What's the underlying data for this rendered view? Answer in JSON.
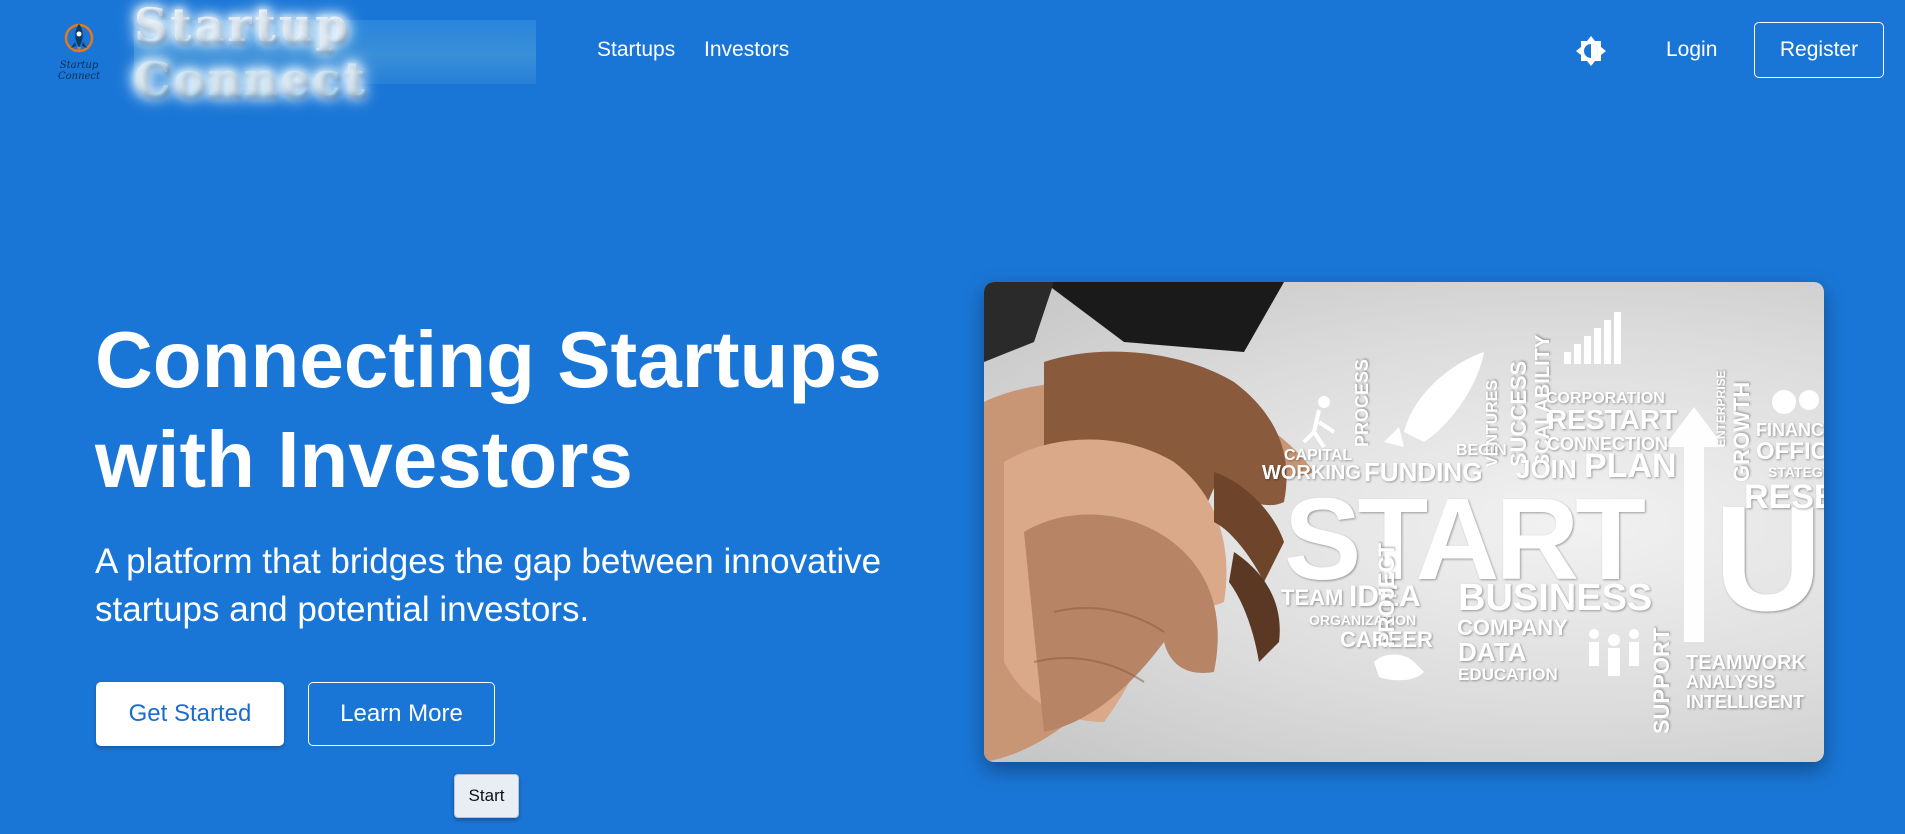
{
  "navbar": {
    "logo_caption": "Startup Connect",
    "brand_title": "Startup Connect",
    "links": {
      "startups": "Startups",
      "investors": "Investors"
    },
    "theme_toggle_icon": "sun-icon",
    "login": "Login",
    "register": "Register"
  },
  "hero": {
    "title_line1": "Connecting Startups",
    "title_line2": "with Investors",
    "subtitle_line1": "A platform that bridges the gap between innovative",
    "subtitle_line2": "startups and potential investors.",
    "get_started": "Get Started",
    "learn_more": "Learn More",
    "tooltip": "Start"
  },
  "hero_image": {
    "words": {
      "start": "START",
      "up": "U",
      "business": "BUSINESS",
      "idea": "IDEA",
      "team": "TEAM",
      "organization": "ORGANIZATION",
      "career": "CAREER",
      "company": "COMPANY",
      "data": "DATA",
      "education": "EDUCATION",
      "project": "PROJECT",
      "support": "SUPPORT",
      "teamwork": "TEAMWORK",
      "analysis": "ANALYSIS",
      "intelligent": "INTELLIGENT",
      "funding": "FUNDING",
      "working": "WORKING",
      "capital": "CAPITAL",
      "process": "PROCESS",
      "begin": "BEGIN",
      "ventures": "VENTURES",
      "success": "SUCCESS",
      "scalability": "SCALABILITY",
      "join": "JOIN",
      "plan": "PLAN",
      "corporation": "CORPORATION",
      "restart": "RESTART",
      "connection": "CONNECTION",
      "enterprise": "ENTERPRISE",
      "growth": "GROWTH",
      "finance": "FINANC",
      "office": "OFFIC",
      "strategy": "STATEGY",
      "research": "RESEA"
    },
    "colors": {
      "background": "#1a76d6",
      "button_text": "#1a6ccf"
    }
  }
}
